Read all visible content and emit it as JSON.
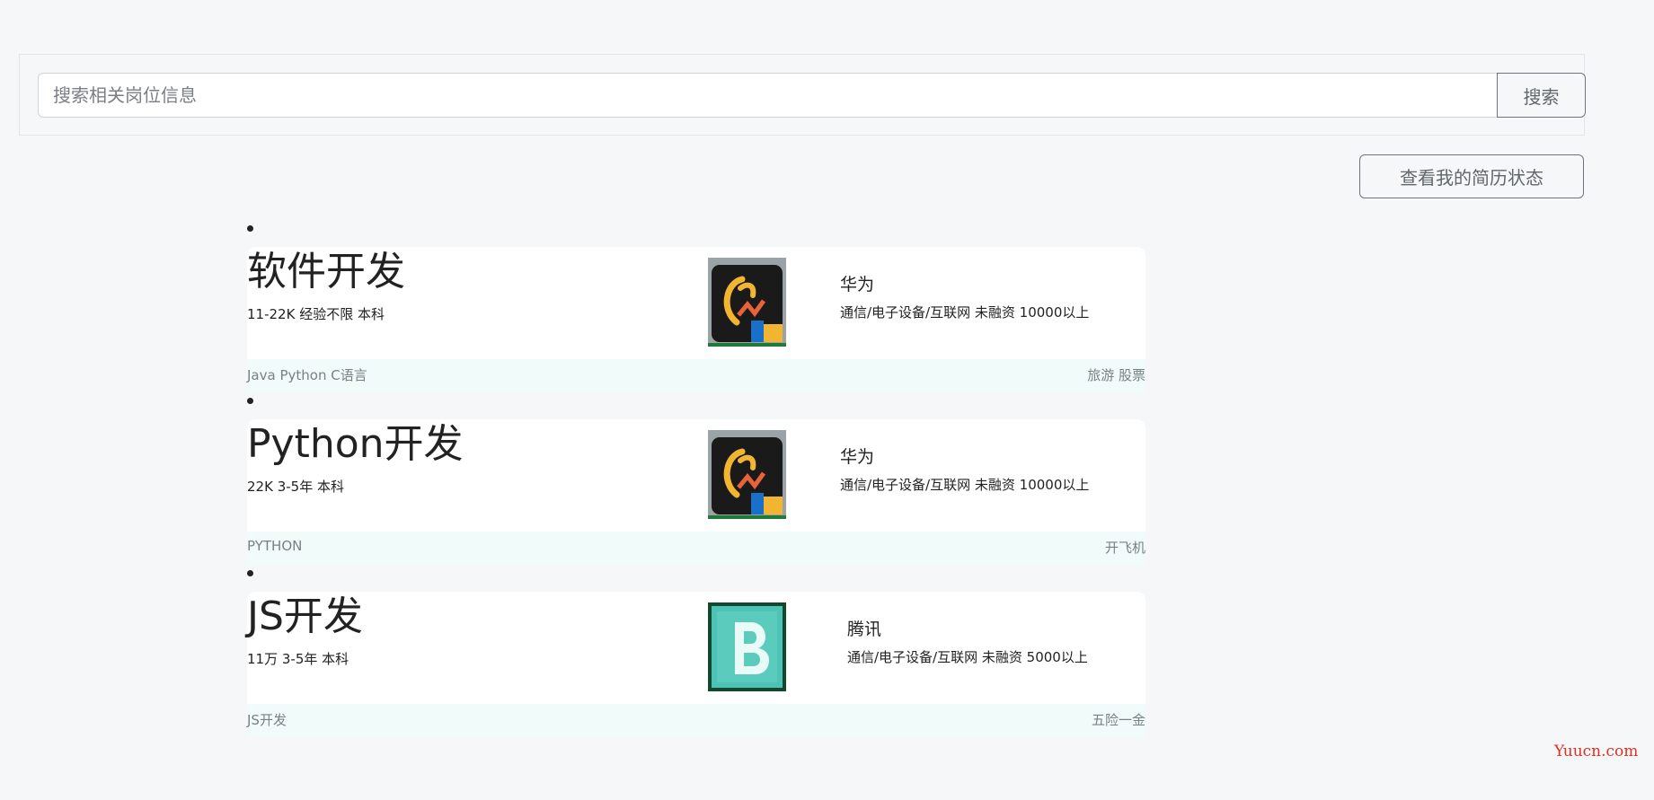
{
  "search": {
    "placeholder": "搜索相关岗位信息",
    "button_label": "搜索"
  },
  "resume_button_label": "查看我的简历状态",
  "jobs": [
    {
      "title": "软件开发",
      "salary": "11-22K",
      "experience": "经验不限",
      "education": "本科",
      "company_name": "华为",
      "company_info": "通信/电子设备/互联网 未融资 10000以上",
      "skills": "Java Python C语言",
      "welfare": "旅游 股票",
      "logo_icon": "huawei-logo-icon"
    },
    {
      "title": "Python开发",
      "salary": "22K",
      "experience": "3-5年",
      "education": "本科",
      "company_name": "华为",
      "company_info": "通信/电子设备/互联网 未融资 10000以上",
      "skills": "PYTHON",
      "welfare": "开飞机",
      "logo_icon": "huawei-logo-icon"
    },
    {
      "title": "JS开发",
      "salary": "11万",
      "experience": "3-5年",
      "education": "本科",
      "company_name": "腾讯",
      "company_info": "通信/电子设备/互联网 未融资 5000以上",
      "skills": "JS开发",
      "welfare": "五险一金",
      "logo_icon": "tencent-logo-icon"
    }
  ],
  "watermark": "Yuucn.com",
  "colors": {
    "page_bg": "#f6f7f9",
    "card_bg": "#ffffff",
    "footer_bg": "#f1fcfa",
    "button_border": "#6c757d",
    "watermark": "#e0301e"
  }
}
